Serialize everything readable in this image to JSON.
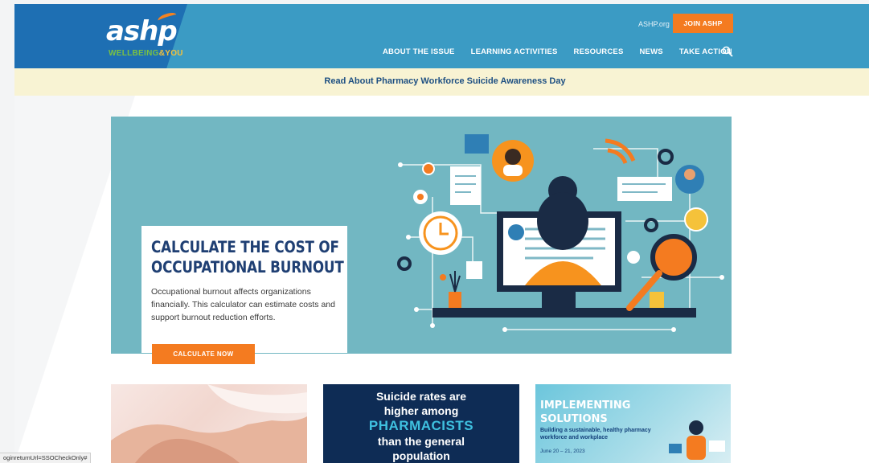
{
  "header": {
    "logo_text": "ashp",
    "logo_sub_1": "WELLBEING",
    "logo_sub_2": "&YOU",
    "ashp_org_link": "ASHP.org",
    "join_button": "JOIN ASHP",
    "nav": [
      {
        "label": "ABOUT THE ISSUE"
      },
      {
        "label": "LEARNING ACTIVITIES"
      },
      {
        "label": "RESOURCES"
      },
      {
        "label": "NEWS"
      },
      {
        "label": "TAKE ACTION"
      }
    ]
  },
  "announcement": {
    "text": "Read About Pharmacy Workforce Suicide Awareness Day"
  },
  "hero": {
    "title_line1": "CALCULATE THE COST OF",
    "title_line2": "OCCUPATIONAL BURNOUT",
    "body": "Occupational burnout affects organizations financially. This calculator can estimate costs and support burnout reduction efforts.",
    "button": "CALCULATE NOW"
  },
  "cards": {
    "card2": {
      "line1": "Suicide rates are",
      "line2": "higher among",
      "highlight": "PHARMACISTS",
      "line3": "than the general",
      "line4": "population"
    },
    "card3": {
      "title_line1": "IMPLEMENTING",
      "title_line2": "SOLUTIONS",
      "subtitle": "Building a sustainable, healthy pharmacy workforce and workplace",
      "date": "June 20 – 21, 2023"
    }
  },
  "status_bar": {
    "text": "oginreturnUrl=SSOCheckOnly#"
  },
  "colors": {
    "header_blue": "#3b9bc4",
    "logo_blue": "#1e6fb3",
    "accent_orange": "#f47b20",
    "navy": "#1f3f73",
    "announce_bg": "#f8f3d3"
  }
}
